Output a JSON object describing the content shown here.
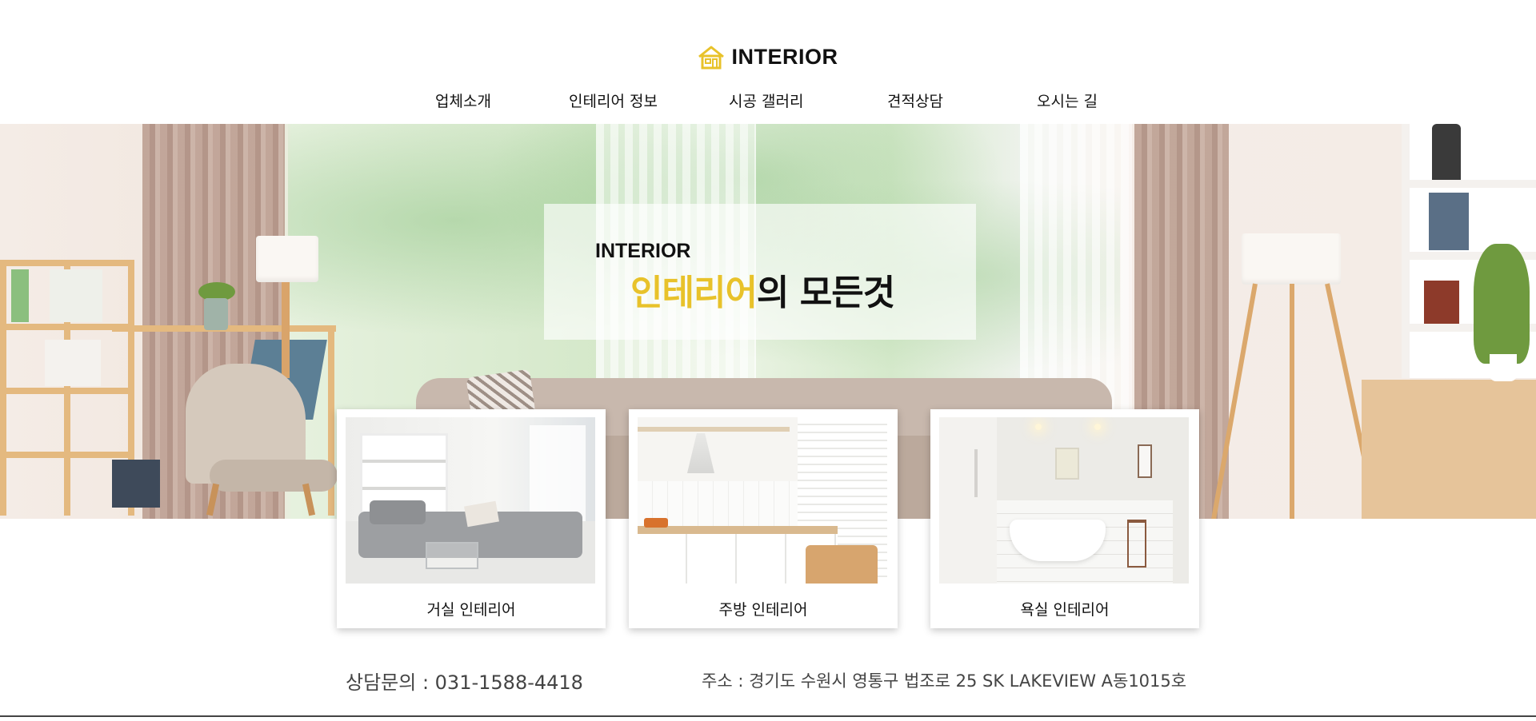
{
  "header": {
    "logo_text": "INTERIOR",
    "logo_icon": "house-icon",
    "nav": [
      "업체소개",
      "인테리어 정보",
      "시공 갤러리",
      "견적상담",
      "오시는 길"
    ]
  },
  "hero": {
    "subtitle": "INTERIOR",
    "title_accent": "인테리어",
    "title_rest": "의 모든것"
  },
  "cards": [
    {
      "label": "거실 인테리어",
      "image": "living-room-photo"
    },
    {
      "label": "주방 인테리어",
      "image": "kitchen-photo"
    },
    {
      "label": "욕실 인테리어",
      "image": "bathroom-photo"
    }
  ],
  "footer": {
    "contact": "상담문의 : 031-1588-4418",
    "address": "주소 : 경기도 수원시 영통구 법조로 25 SK LAKEVIEW A동1015호"
  },
  "colors": {
    "accent": "#e8c22a",
    "text": "#111111",
    "footer_text": "#444444"
  }
}
